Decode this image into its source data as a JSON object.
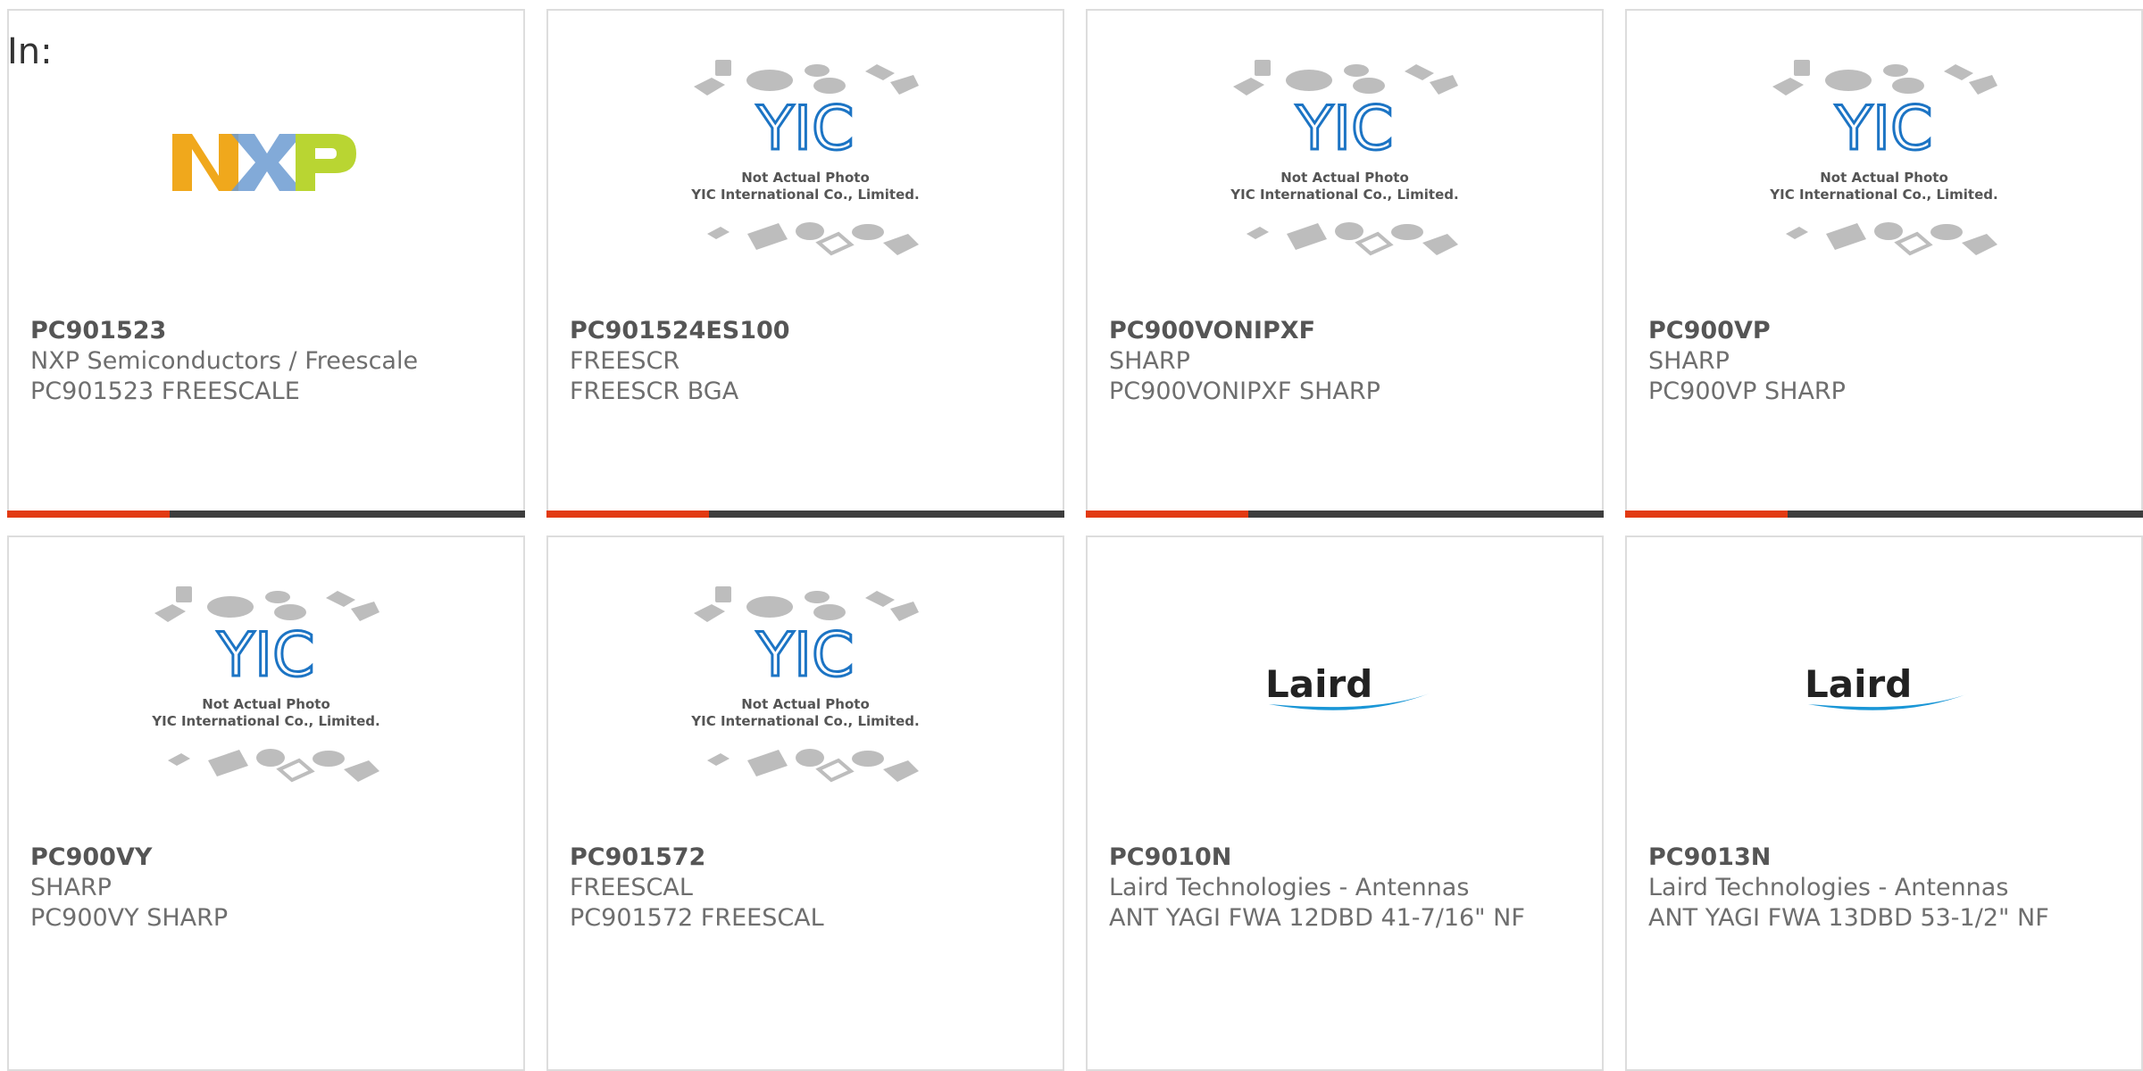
{
  "header": {
    "in_label": "In:"
  },
  "placeholder_text": {
    "line1": "Not Actual Photo",
    "line2": "YIC International Co., Limited.",
    "logo": "YIC"
  },
  "brand_logos": {
    "nxp": "NXP",
    "laird": "Laird"
  },
  "colors": {
    "accent": "#e23a12",
    "bar": "#3d3d3d",
    "nxp_n": "#f0a81c",
    "nxp_x": "#6c9bd1",
    "nxp_p": "#b9d532",
    "yic_blue": "#1c74c4",
    "laird_swoosh": "#1a96d6"
  },
  "products": [
    {
      "part": "PC901523",
      "maker": "NXP Semiconductors / Freescale",
      "desc": "PC901523 FREESCALE",
      "image": "nxp-logo"
    },
    {
      "part": "PC901524ES100",
      "maker": "FREESCR",
      "desc": "FREESCR BGA",
      "image": "placeholder"
    },
    {
      "part": "PC900VONIPXF",
      "maker": "SHARP",
      "desc": "PC900VONIPXF SHARP",
      "image": "placeholder"
    },
    {
      "part": "PC900VP",
      "maker": "SHARP",
      "desc": "PC900VP SHARP",
      "image": "placeholder"
    },
    {
      "part": "PC900VY",
      "maker": "SHARP",
      "desc": "PC900VY SHARP",
      "image": "placeholder"
    },
    {
      "part": "PC901572",
      "maker": "FREESCAL",
      "desc": "PC901572 FREESCAL",
      "image": "placeholder"
    },
    {
      "part": "PC9010N",
      "maker": "Laird Technologies - Antennas",
      "desc": "ANT YAGI FWA 12DBD 41-7/16\" NF",
      "image": "laird-logo"
    },
    {
      "part": "PC9013N",
      "maker": "Laird Technologies - Antennas",
      "desc": "ANT YAGI FWA 13DBD 53-1/2\" NF",
      "image": "laird-logo"
    }
  ]
}
